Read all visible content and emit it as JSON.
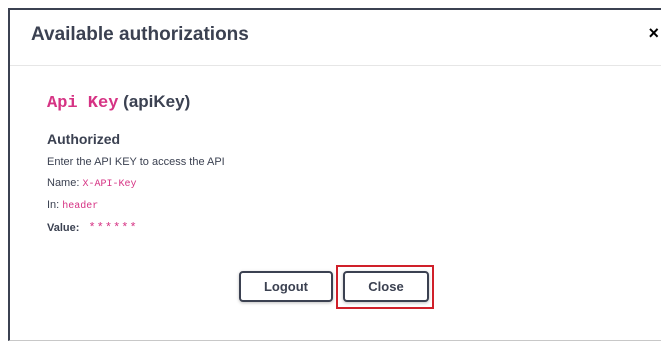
{
  "dialog": {
    "title": "Available authorizations",
    "close_symbol": "×"
  },
  "scheme": {
    "name": "Api Key",
    "id": "(apiKey)",
    "status": "Authorized",
    "description": "Enter the API KEY to access the API",
    "name_label": "Name:",
    "name_value": "X-API-Key",
    "in_label": "In:",
    "in_value": "header",
    "value_label": "Value:",
    "value_masked": "******"
  },
  "buttons": {
    "logout": "Logout",
    "close": "Close"
  },
  "colors": {
    "text": "#3b4151",
    "code": "#d63384",
    "highlight": "#d0202a"
  },
  "icons": {
    "close": "close-icon"
  }
}
